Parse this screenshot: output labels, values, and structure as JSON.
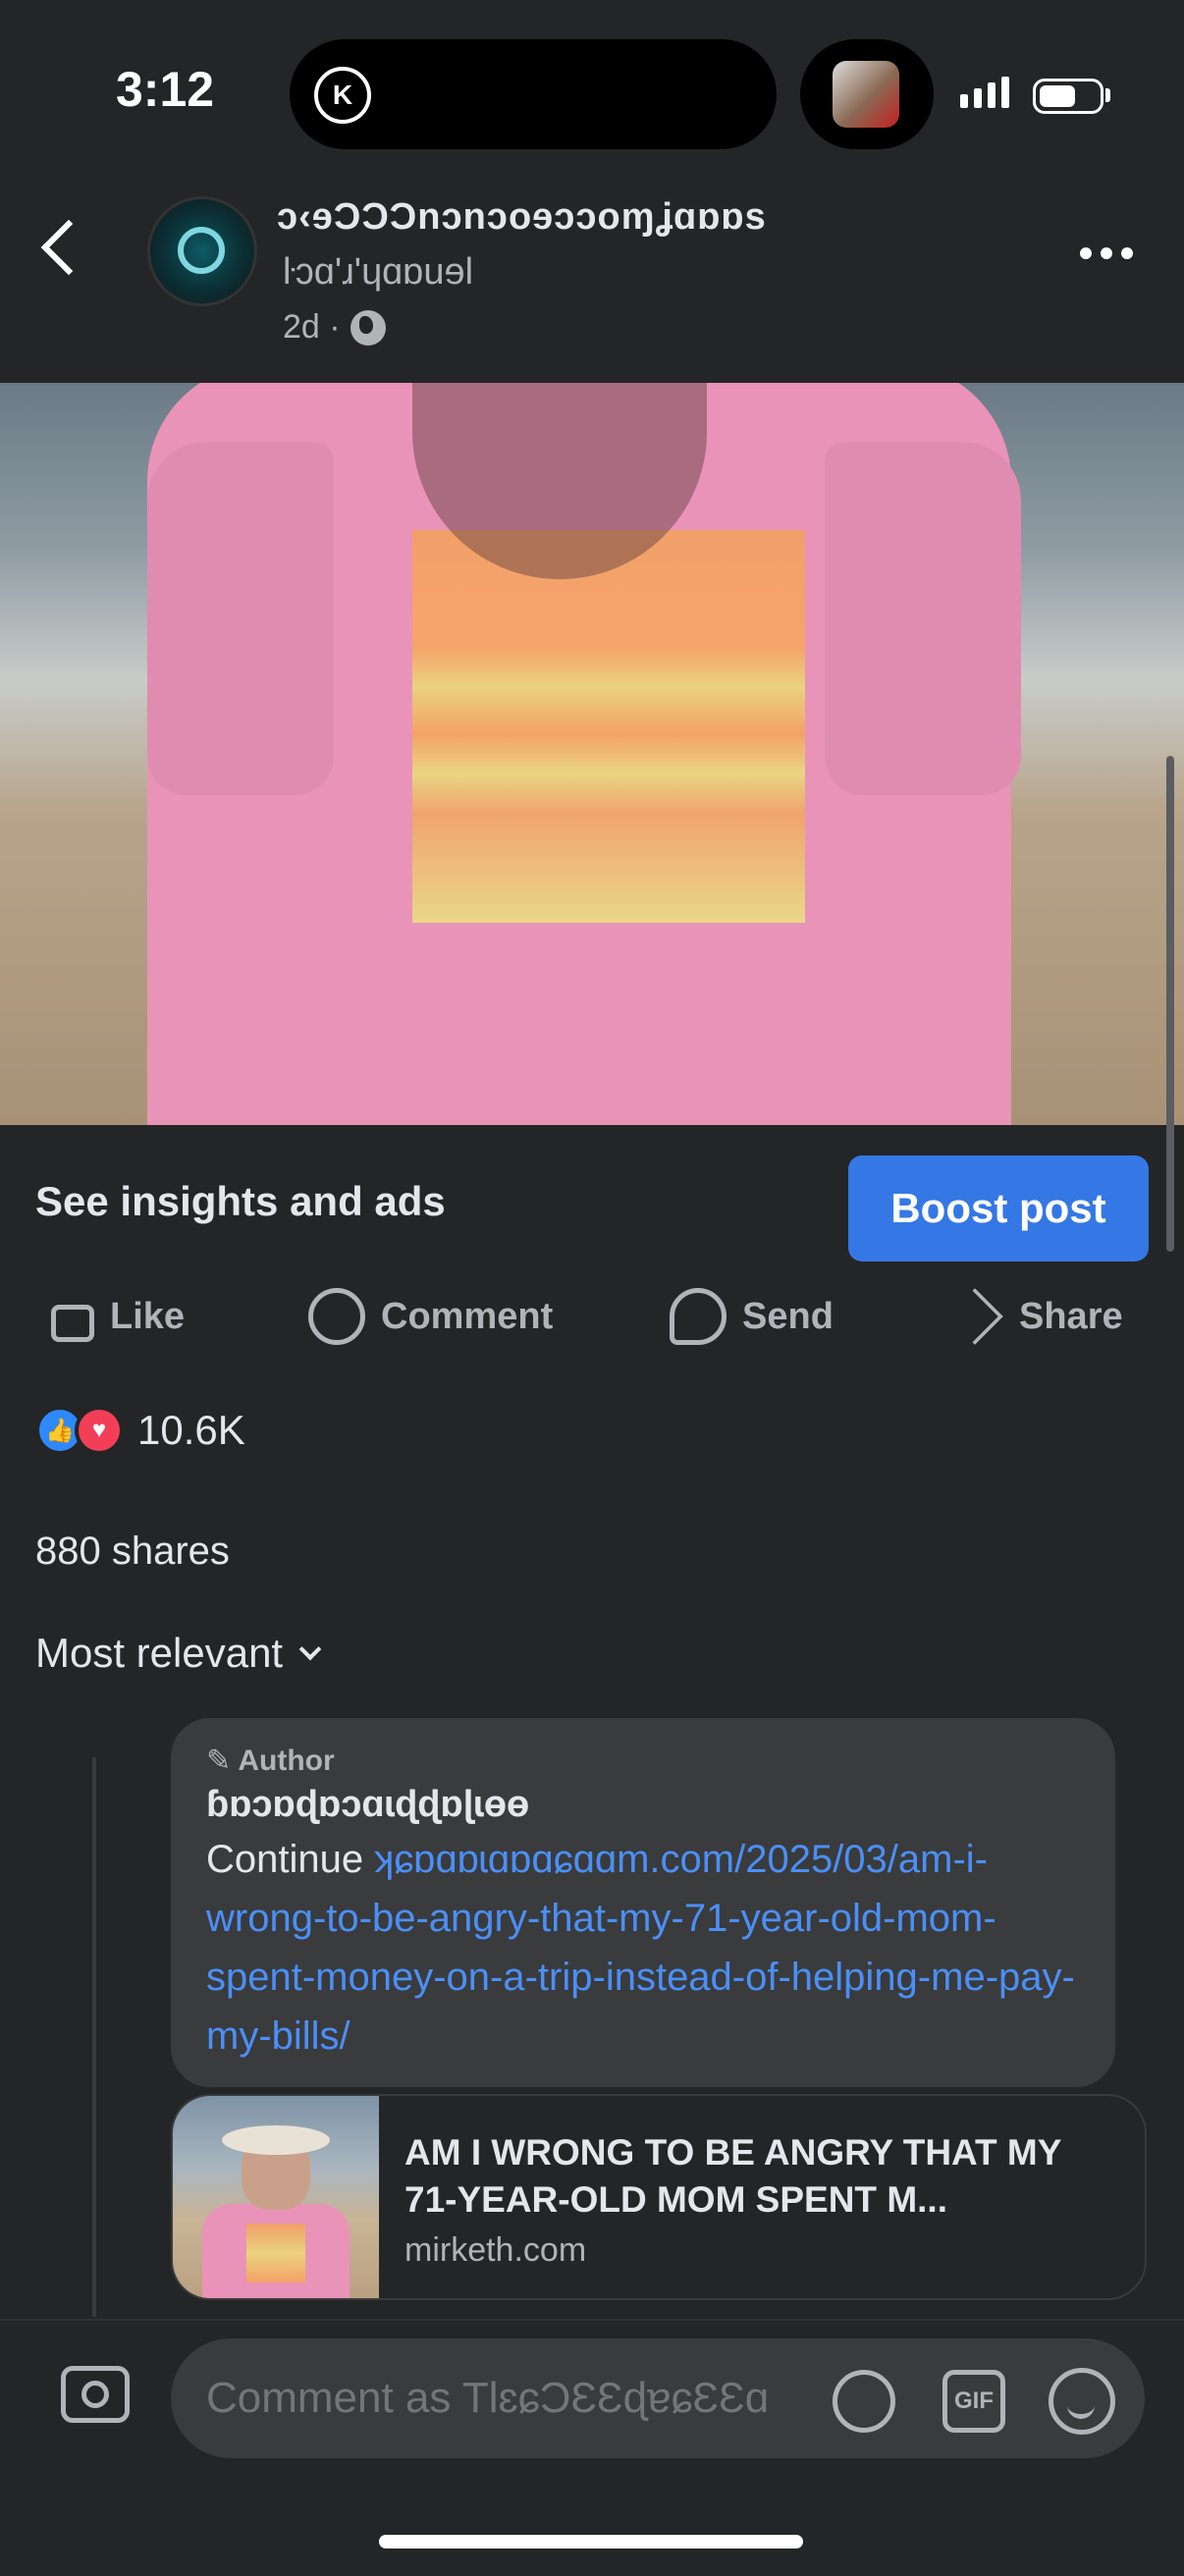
{
  "status_bar": {
    "time": "3:12",
    "island_letter": "K"
  },
  "header": {
    "page_name": "ɔ‹ɘƆƆƆnɔnɔoɘɔɔoɱʝɑɒɒs",
    "page_subtitle": "ŀɔɑ'ɹ'ɥɑɒuɘl",
    "post_age": "2d ·"
  },
  "insights": {
    "label": "See insights and ads",
    "boost_label": "Boost post"
  },
  "actions": {
    "like": "Like",
    "comment": "Comment",
    "send": "Send",
    "share": "Share"
  },
  "engagement": {
    "reaction_count": "10.6K",
    "shares": "880 shares",
    "sort_label": "Most relevant"
  },
  "comment": {
    "author_badge": "✎ Author",
    "commenter_name": "ɓɒɔɒɖɒɔɑɩɖɖɒɭɩɵɵ",
    "text_prefix": "Continue ",
    "link_text": "ʞɕɒɑɒɩɑɒɑɕɑɑm.com/2025/03/am-i-wrong-to-be-angry-that-my-71-year-old-mom-spent-money-on-a-trip-instead-of-helping-me-pay-my-bills/"
  },
  "link_card": {
    "title": "AM I WRONG TO BE ANGRY THAT MY 71-YEAR-OLD MOM SPENT M...",
    "domain": "mirketh.com"
  },
  "composer": {
    "placeholder": "Comment as TlɛɕƆƐƐɖɐɕƐƐɑ",
    "gif_label": "GIF"
  }
}
